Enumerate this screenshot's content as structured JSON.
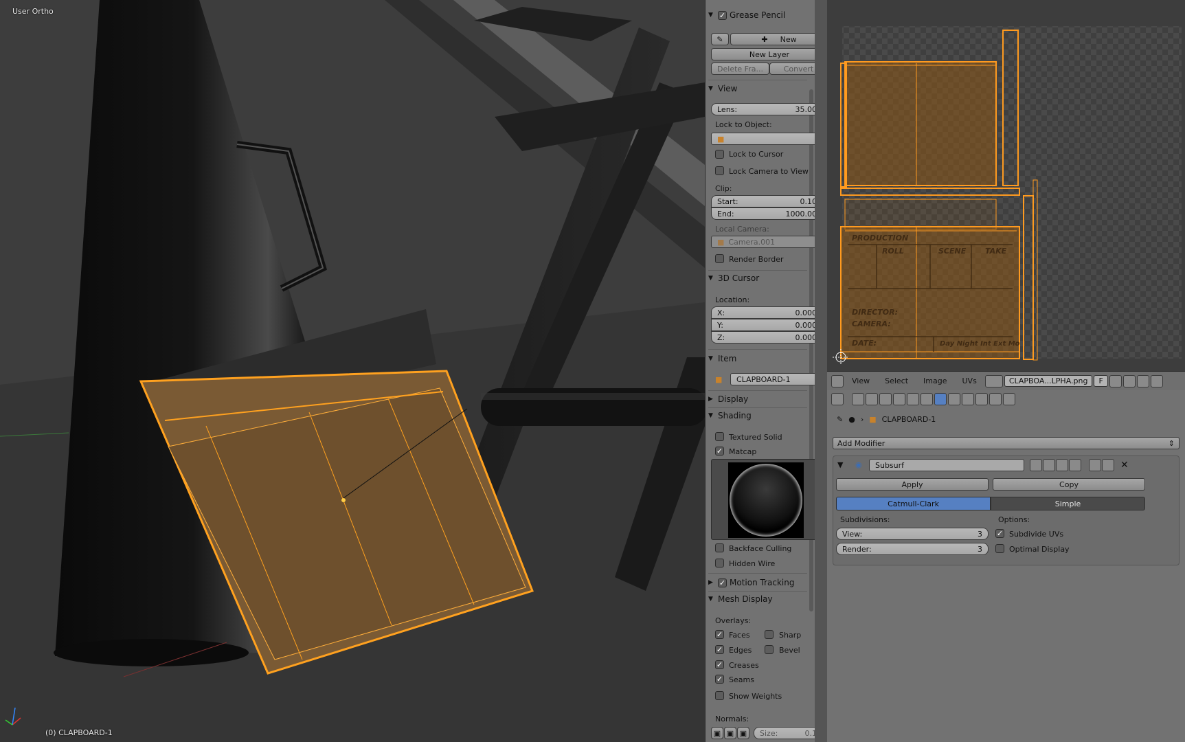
{
  "viewport": {
    "view_name": "User Ortho",
    "object_label": "(0) CLAPBOARD-1"
  },
  "npanel": {
    "grease_pencil": {
      "title": "Grease Pencil",
      "enabled": true,
      "new_label": "New",
      "new_layer_label": "New Layer",
      "delete_frame_label": "Delete Fra...",
      "convert_label": "Convert"
    },
    "view": {
      "title": "View",
      "lens_label": "Lens:",
      "lens_value": "35.000",
      "lock_to_object_label": "Lock to Object:",
      "lock_to_cursor": "Lock to Cursor",
      "lock_camera_to_view": "Lock Camera to View",
      "clip_label": "Clip:",
      "start_label": "Start:",
      "start_value": "0.100",
      "end_label": "End:",
      "end_value": "1000.000",
      "local_camera_label": "Local Camera:",
      "local_camera_value": "Camera.001",
      "render_border": "Render Border"
    },
    "cursor": {
      "title": "3D Cursor",
      "location_label": "Location:",
      "x_label": "X:",
      "x_value": "0.0000",
      "y_label": "Y:",
      "y_value": "0.0000",
      "z_label": "Z:",
      "z_value": "0.0000"
    },
    "item": {
      "title": "Item",
      "name": "CLAPBOARD-1"
    },
    "display": {
      "title": "Display"
    },
    "shading": {
      "title": "Shading",
      "textured_solid": "Textured Solid",
      "matcap": "Matcap",
      "backface_culling": "Backface Culling",
      "hidden_wire": "Hidden Wire"
    },
    "motion_tracking": {
      "title": "Motion Tracking"
    },
    "mesh_display": {
      "title": "Mesh Display",
      "overlays_label": "Overlays:",
      "faces": "Faces",
      "edges": "Edges",
      "creases": "Creases",
      "seams": "Seams",
      "sharp": "Sharp",
      "bevel": "Bevel",
      "show_weights": "Show Weights",
      "normals_label": "Normals:",
      "size_label": "Size:",
      "size_value": "0.10"
    }
  },
  "uv_editor": {
    "menus": [
      "View",
      "Select",
      "Image",
      "UVs"
    ],
    "image_name": "CLAPBOA...LPHA.png",
    "f_label": "F",
    "uv_text": {
      "production": "PRODUCTION",
      "roll": "ROLL",
      "scene": "SCENE",
      "take": "TAKE",
      "director": "DIRECTOR:",
      "camera": "CAMERA:",
      "date": "DATE:",
      "day_night": "Day Night Int Ext Mo"
    }
  },
  "properties": {
    "object_name": "CLAPBOARD-1",
    "add_modifier_label": "Add Modifier",
    "modifier": {
      "name": "Subsurf",
      "apply_label": "Apply",
      "copy_label": "Copy",
      "catmull_label": "Catmull-Clark",
      "simple_label": "Simple",
      "subdivisions_label": "Subdivisions:",
      "view_label": "View:",
      "view_value": "3",
      "render_label": "Render:",
      "render_value": "3",
      "options_label": "Options:",
      "subdivide_uvs": "Subdivide UVs",
      "optimal_display": "Optimal Display"
    }
  },
  "colors": {
    "accent": "#5680c2",
    "selection": "#ff9a1f",
    "panel_bg": "#727272"
  }
}
